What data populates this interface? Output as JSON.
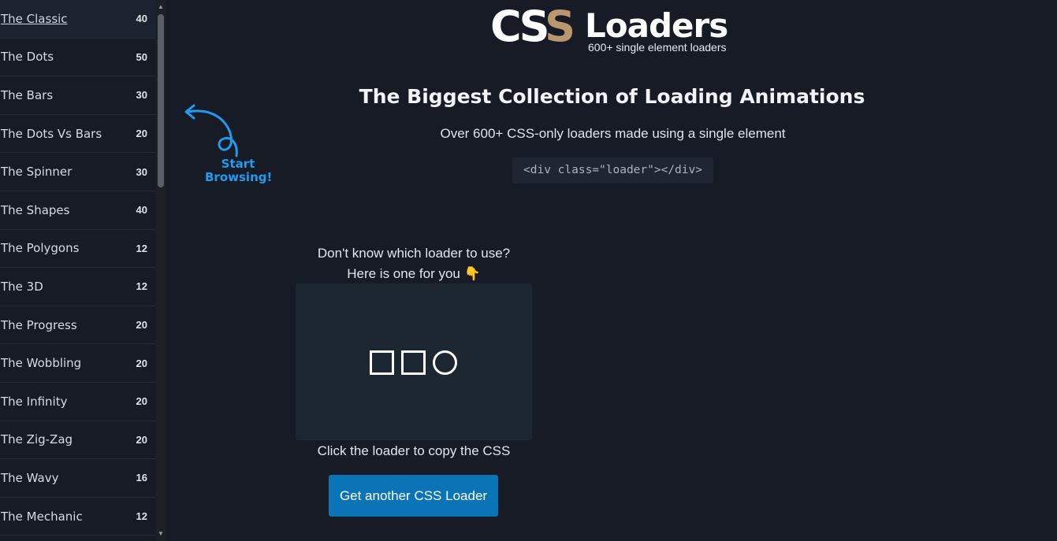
{
  "sidebar": {
    "items": [
      {
        "label": "The Classic",
        "count": "40"
      },
      {
        "label": "The Dots",
        "count": "50"
      },
      {
        "label": "The Bars",
        "count": "30"
      },
      {
        "label": "The Dots Vs Bars",
        "count": "20"
      },
      {
        "label": "The Spinner",
        "count": "30"
      },
      {
        "label": "The Shapes",
        "count": "40"
      },
      {
        "label": "The Polygons",
        "count": "12"
      },
      {
        "label": "The 3D",
        "count": "12"
      },
      {
        "label": "The Progress",
        "count": "20"
      },
      {
        "label": "The Wobbling",
        "count": "20"
      },
      {
        "label": "The Infinity",
        "count": "20"
      },
      {
        "label": "The Zig-Zag",
        "count": "20"
      },
      {
        "label": "The Wavy",
        "count": "16"
      },
      {
        "label": "The Mechanic",
        "count": "12"
      }
    ]
  },
  "logo": {
    "css_left": "C",
    "css_s": "S",
    "css_mid": "S",
    "name": "Loaders",
    "tagline": "600+ single element loaders"
  },
  "hero": {
    "title": "The Biggest Collection of Loading Animations",
    "subtitle": "Over 600+ CSS-only loaders made using a single element",
    "code": "<div class=\"loader\"></div>"
  },
  "start_hint": {
    "line1": "Start",
    "line2": "Browsing!"
  },
  "random": {
    "question": "Don't know which loader to use?",
    "here": "Here is one for you 👇",
    "copy_hint": "Click the loader to copy the CSS",
    "button": "Get another CSS Loader"
  },
  "colors": {
    "background": "#161b26",
    "accent": "#0a74b7",
    "hint": "#1f9bf0",
    "logo_s": "#b9986f"
  }
}
